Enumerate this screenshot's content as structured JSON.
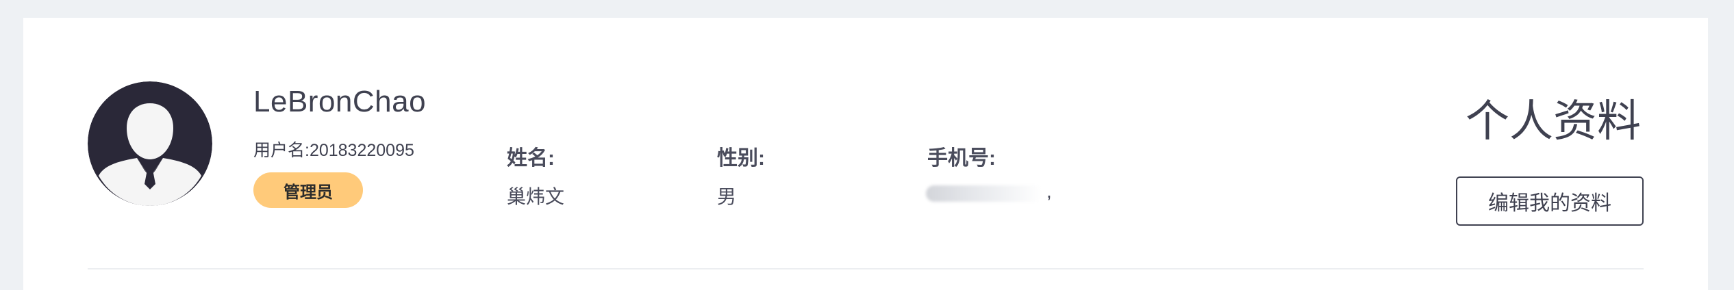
{
  "profile": {
    "display_name": "LeBronChao",
    "username_line": "用户名:20183220095",
    "role_badge": "管理员",
    "avatar_icon": "user-silhouette-icon"
  },
  "fields": {
    "name_label": "姓名:",
    "name_value": "巢炜文",
    "gender_label": "性别:",
    "gender_value": "男",
    "phone_label": "手机号:",
    "phone_value_suffix": ","
  },
  "header": {
    "title": "个人资料",
    "edit_label": "编辑我的资料"
  },
  "colors": {
    "background": "#eef1f4",
    "card": "#ffffff",
    "text": "#3f4150",
    "badge": "#ffca7a",
    "avatar_dark": "#2a2838"
  }
}
